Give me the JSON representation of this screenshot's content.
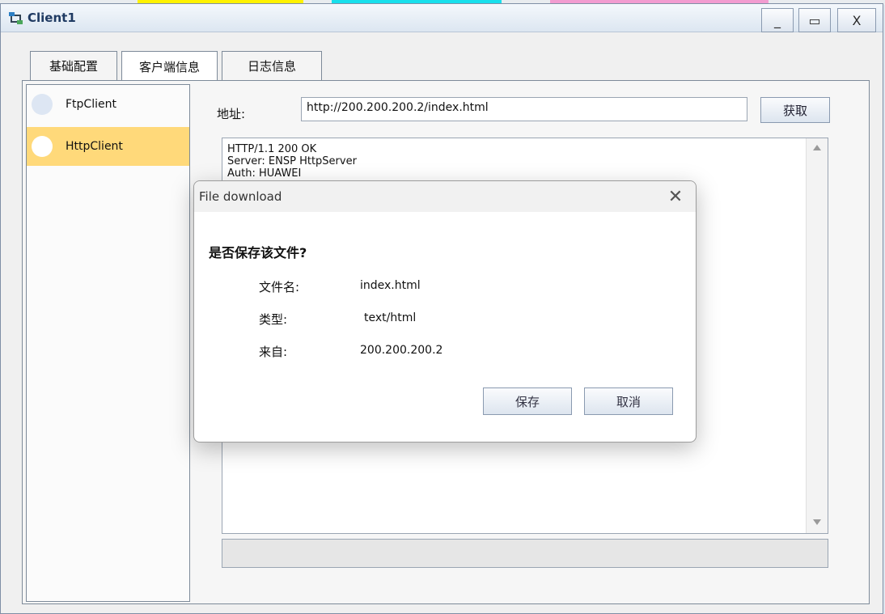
{
  "window": {
    "title": "Client1",
    "minimize_glyph": "_",
    "maximize_glyph": "▭",
    "close_glyph": "X"
  },
  "tabs": [
    {
      "label": "基础配置"
    },
    {
      "label": "客户端信息"
    },
    {
      "label": "日志信息"
    }
  ],
  "sidebar": {
    "items": [
      {
        "label": "FtpClient"
      },
      {
        "label": "HttpClient"
      }
    ]
  },
  "main": {
    "address_label": "地址:",
    "address_value": "http://200.200.200.2/index.html",
    "fetch_label": "获取",
    "response_text": "HTTP/1.1 200 OK\nServer: ENSP HttpServer\nAuth: HUAWEI"
  },
  "dialog": {
    "title": "File download",
    "close_glyph": "✕",
    "question": "是否保存该文件?",
    "filename_label": "文件名:",
    "filename_value": "index.html",
    "type_label": "类型:",
    "type_value": "text/html",
    "from_label": "来自:",
    "from_value": "200.200.200.2",
    "save_label": "保存",
    "cancel_label": "取消"
  },
  "icons": {
    "app": "network-client-icon",
    "sidebar_items": "circle-icon"
  },
  "colors": {
    "selected_item": "#ffd97a",
    "title_text": "#1f3a62"
  }
}
